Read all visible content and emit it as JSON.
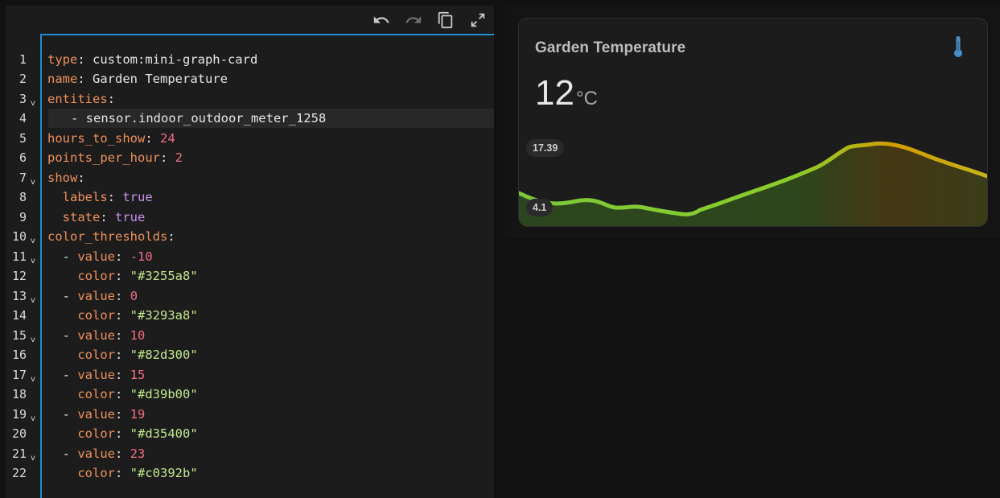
{
  "editor": {
    "toolbar": {
      "undo_icon": "undo-icon",
      "redo_icon": "redo-icon",
      "copy_icon": "copy-icon",
      "fullscreen_icon": "fullscreen-icon"
    },
    "line_numbers": [
      "1",
      "2",
      "3",
      "4",
      "5",
      "6",
      "7",
      "8",
      "9",
      "10",
      "11",
      "12",
      "13",
      "14",
      "15",
      "16",
      "17",
      "18",
      "19",
      "20",
      "21",
      "22"
    ],
    "code": {
      "l1": {
        "key": "type",
        "sep": ": ",
        "val": "custom:mini-graph-card"
      },
      "l2": {
        "key": "name",
        "sep": ": ",
        "val": "Garden Temperature"
      },
      "l3": {
        "key": "entities",
        "sep": ":"
      },
      "l4": {
        "dash": "- ",
        "val": "sensor.indoor_outdoor_meter_1258"
      },
      "l5": {
        "key": "hours_to_show",
        "sep": ": ",
        "val": "24"
      },
      "l6": {
        "key": "points_per_hour",
        "sep": ": ",
        "val": "2"
      },
      "l7": {
        "key": "show",
        "sep": ":"
      },
      "l8": {
        "key": "labels",
        "sep": ": ",
        "val": "true"
      },
      "l9": {
        "key": "state",
        "sep": ": ",
        "val": "true"
      },
      "l10": {
        "key": "color_thresholds",
        "sep": ":"
      },
      "l11": {
        "dash": "- ",
        "key": "value",
        "sep": ": ",
        "val": "-10"
      },
      "l12": {
        "key": "color",
        "sep": ": ",
        "val": "\"#3255a8\""
      },
      "l13": {
        "dash": "- ",
        "key": "value",
        "sep": ": ",
        "val": "0"
      },
      "l14": {
        "key": "color",
        "sep": ": ",
        "val": "\"#3293a8\""
      },
      "l15": {
        "dash": "- ",
        "key": "value",
        "sep": ": ",
        "val": "10"
      },
      "l16": {
        "key": "color",
        "sep": ": ",
        "val": "\"#82d300\""
      },
      "l17": {
        "dash": "- ",
        "key": "value",
        "sep": ": ",
        "val": "15"
      },
      "l18": {
        "key": "color",
        "sep": ": ",
        "val": "\"#d39b00\""
      },
      "l19": {
        "dash": "- ",
        "key": "value",
        "sep": ": ",
        "val": "19"
      },
      "l20": {
        "key": "color",
        "sep": ": ",
        "val": "\"#d35400\""
      },
      "l21": {
        "dash": "- ",
        "key": "value",
        "sep": ": ",
        "val": "23"
      },
      "l22": {
        "key": "color",
        "sep": ": ",
        "val": "\"#c0392b\""
      }
    }
  },
  "card": {
    "title": "Garden Temperature",
    "icon": "thermometer-icon",
    "state": "12",
    "unit": "°C",
    "label_max": "17.39",
    "label_min": "4.1",
    "colors": {
      "accent_icon": "#4a90c8",
      "line_green": "#82d300",
      "line_yellow": "#d39b00"
    }
  }
}
